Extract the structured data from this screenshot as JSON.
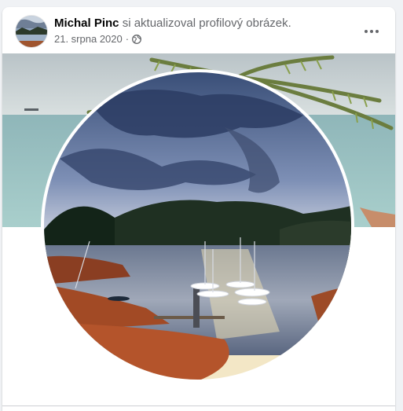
{
  "post": {
    "author_name": "Michal Pinc",
    "action_text": " si aktualizoval profilový obrázek.",
    "date": "21. srpna 2020",
    "separator": "·",
    "audience_icon": "globe-icon",
    "more_icon": "more-options-icon"
  },
  "images": {
    "avatar": "profile-avatar-lake",
    "cover": "cover-photo-beach-palm",
    "profile_photo": "profile-photo-lake-marina"
  },
  "colors": {
    "background": "#f0f2f5",
    "card": "#ffffff",
    "primary_text": "#050505",
    "secondary_text": "#65676b"
  }
}
